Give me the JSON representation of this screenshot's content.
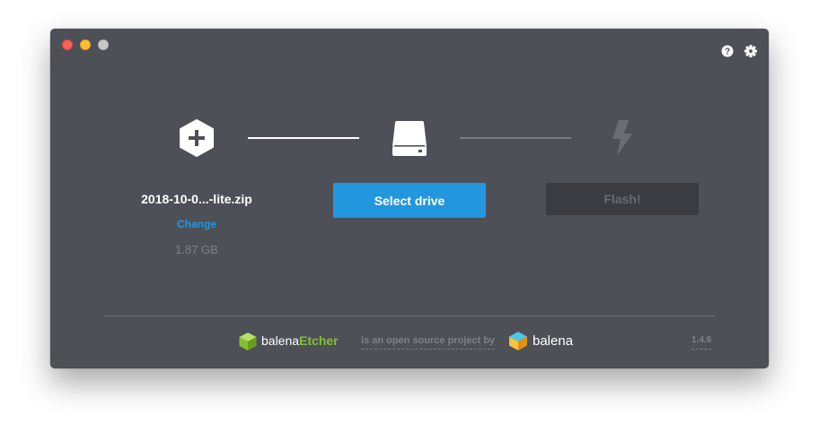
{
  "window": {
    "controls": [
      "close",
      "minimize",
      "maximize"
    ],
    "top_icons": [
      "help-icon",
      "settings-icon"
    ]
  },
  "steps": {
    "image": {
      "icon": "plus-hexagon-icon",
      "filename": "2018-10-0...-lite.zip",
      "change_label": "Change",
      "size": "1.87 GB"
    },
    "drive": {
      "icon": "drive-icon",
      "button_label": "Select drive"
    },
    "flash": {
      "icon": "lightning-icon",
      "button_label": "Flash!"
    }
  },
  "footer": {
    "etcher_prefix": "balena",
    "etcher_suffix": "Etcher",
    "tagline": "is an open source project by",
    "balena": "balena",
    "version": "1.4.6"
  },
  "colors": {
    "window_bg": "#4d5057",
    "accent": "#2297de",
    "etcher_green": "#85c12d",
    "muted": "#7e8085",
    "disabled_button": "#3a3c41"
  }
}
